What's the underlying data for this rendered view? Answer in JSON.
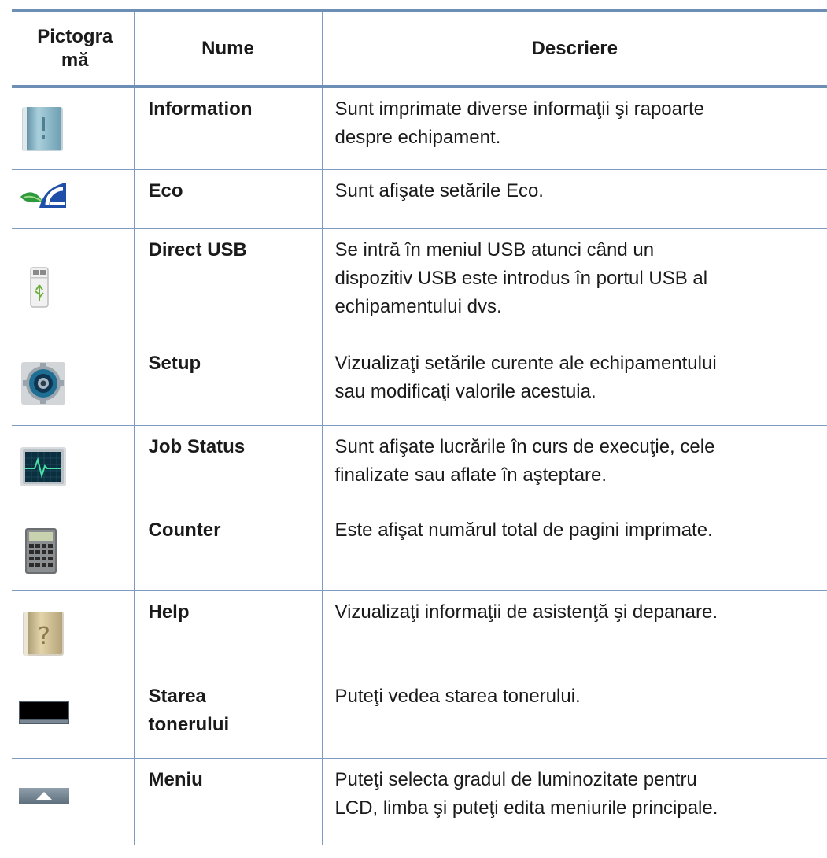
{
  "header": {
    "icon": "Pictogra\nmă",
    "icon_line1": "Pictogra",
    "icon_line2": "mă",
    "name": "Nume",
    "description": "Descriere"
  },
  "rows": [
    {
      "icon": "information-icon",
      "name": "Information",
      "desc_lines": [
        "Sunt imprimate diverse informaţii şi rapoarte",
        "despre echipament."
      ]
    },
    {
      "icon": "eco-icon",
      "name": "Eco",
      "desc_lines": [
        "Sunt afişate setările Eco."
      ]
    },
    {
      "icon": "usb-drive-icon",
      "name": "Direct USB",
      "desc_lines": [
        "Se intră în meniul USB atunci când un",
        "dispozitiv USB este introdus în portul USB al",
        "echipamentului dvs."
      ]
    },
    {
      "icon": "setup-gear-icon",
      "name": "Setup",
      "desc_lines": [
        "Vizualizaţi setările curente ale echipamentului",
        "sau modificaţi valorile acestuia."
      ]
    },
    {
      "icon": "job-status-monitor-icon",
      "name": "Job Status",
      "desc_lines": [
        "Sunt afişate lucrările în curs de execuţie, cele",
        "finalizate sau aflate în aşteptare."
      ]
    },
    {
      "icon": "calculator-icon",
      "name": "Counter",
      "desc_lines": [
        "Este afişat numărul total de pagini imprimate."
      ]
    },
    {
      "icon": "help-book-icon",
      "name": "Help",
      "desc_lines": [
        "Vizualizaţi informaţii de asistenţă şi depanare."
      ]
    },
    {
      "icon": "toner-status-icon",
      "name_lines": [
        "Starea",
        "tonerului"
      ],
      "desc_lines": [
        "Puteţi vedea starea tonerului."
      ]
    },
    {
      "icon": "menu-arrow-icon",
      "name": "Meniu",
      "desc_lines": [
        "Puteţi selecta gradul de luminozitate pentru",
        "LCD, limba şi puteţi edita meniurile principale."
      ]
    }
  ],
  "colors": {
    "rule": "#6d8fb6",
    "grid": "#7f9bbf"
  }
}
